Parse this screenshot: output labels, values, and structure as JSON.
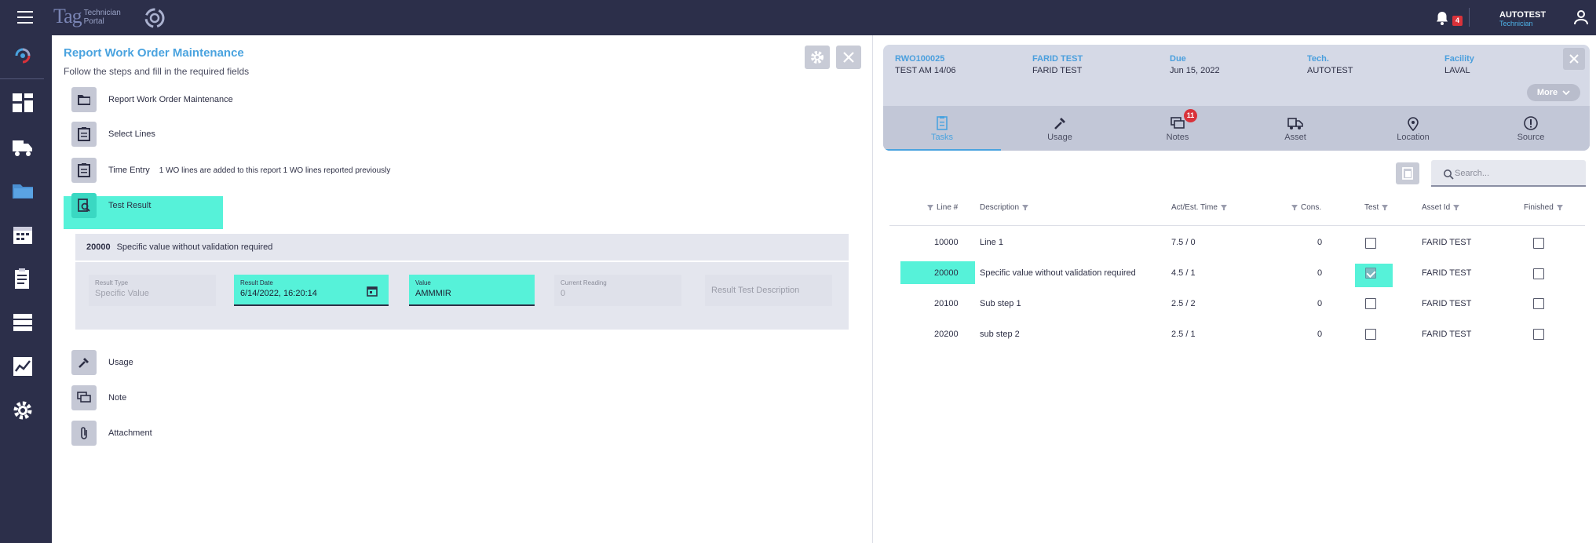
{
  "app": {
    "brand_tag": "Tag",
    "brand_sub_line1": "Technician",
    "brand_sub_line2": "Portal",
    "notification_count": "4",
    "user_name": "AUTOTEST",
    "user_role": "Technician"
  },
  "nav": {
    "icons": [
      "tag-logo-icon",
      "dashboard-icon",
      "truck-icon",
      "folder-icon",
      "calendar-icon",
      "clipboard-icon",
      "list-icon",
      "chart-icon",
      "settings-icon"
    ],
    "active": "folder-icon"
  },
  "left_panel": {
    "title": "Report Work Order Maintenance",
    "subtitle": "Follow the steps and fill in the required fields",
    "steps": [
      {
        "label": "Report Work Order Maintenance",
        "icon": "folder-icon"
      },
      {
        "label": "Select Lines",
        "icon": "clipboard-icon"
      },
      {
        "label": "Time Entry",
        "icon": "clipboard-icon",
        "extra": "1 WO lines are added to this report 1 WO lines reported previously"
      },
      {
        "label": "Test Result",
        "icon": "search-document-icon"
      },
      {
        "label": "Usage",
        "icon": "wrench-icon"
      },
      {
        "label": "Note",
        "icon": "chat-icon"
      },
      {
        "label": "Attachment",
        "icon": "paperclip-icon"
      }
    ],
    "result": {
      "line_number": "20000",
      "line_description": "Specific value without validation required",
      "result_type_label": "Result Type",
      "result_type_value": "Specific Value",
      "result_date_label": "Result Date",
      "result_date_value": "6/14/2022, 16:20:14",
      "value_label": "Value",
      "value_value": "AMMMIR",
      "current_reading_label": "Current Reading",
      "current_reading_value": "0",
      "description_placeholder": "Result Test Description"
    }
  },
  "work_order": {
    "number": "RWO100025",
    "name": "TEST AM 14/06",
    "asset_label": "FARID TEST",
    "asset_value": "FARID TEST",
    "due_label": "Due",
    "due_value": "Jun 15, 2022",
    "tech_label": "Tech.",
    "tech_value": "AUTOTEST",
    "facility_label": "Facility",
    "facility_value": "LAVAL",
    "more_label": "More",
    "tabs": [
      {
        "label": "Tasks",
        "icon": "tasks-icon",
        "active": true
      },
      {
        "label": "Usage",
        "icon": "wrench-icon"
      },
      {
        "label": "Notes",
        "icon": "chat-icon",
        "badge": "11"
      },
      {
        "label": "Asset",
        "icon": "truck-icon"
      },
      {
        "label": "Location",
        "icon": "pin-icon"
      },
      {
        "label": "Source",
        "icon": "alert-icon"
      }
    ]
  },
  "tasks_table": {
    "search_placeholder": "Search...",
    "columns": [
      "Line #",
      "Description",
      "Act/Est. Time",
      "Cons.",
      "Test",
      "Asset Id",
      "Finished"
    ],
    "rows": [
      {
        "line": "10000",
        "description": "Line 1",
        "time": "7.5 / 0",
        "cons": "0",
        "test": false,
        "asset": "FARID TEST",
        "finished": false,
        "highlight": false
      },
      {
        "line": "20000",
        "description": "Specific value without validation required",
        "time": "4.5 / 1",
        "cons": "0",
        "test": true,
        "asset": "FARID TEST",
        "finished": false,
        "highlight": true
      },
      {
        "line": "20100",
        "description": "Sub step 1",
        "time": "2.5 / 2",
        "cons": "0",
        "test": false,
        "asset": "FARID TEST",
        "finished": false,
        "highlight": false
      },
      {
        "line": "20200",
        "description": "sub step 2",
        "time": "2.5 / 1",
        "cons": "0",
        "test": false,
        "asset": "FARID TEST",
        "finished": false,
        "highlight": false
      }
    ]
  },
  "colors": {
    "topbar": "#2c2f4a",
    "accent": "#4aa3df",
    "highlight": "#56f2d9",
    "badge": "#d9323a"
  }
}
